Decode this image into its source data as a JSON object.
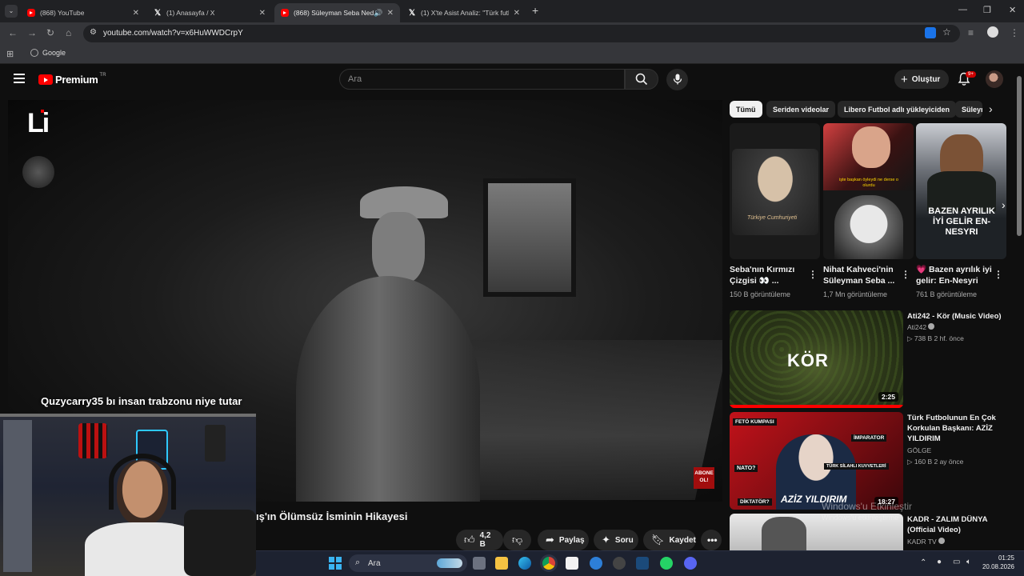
{
  "browser": {
    "tabs": [
      {
        "label": "(868) YouTube",
        "icon": "youtube"
      },
      {
        "label": "(1) Anasayfa / X",
        "icon": "x"
      },
      {
        "label": "(868) Süleyman Seba Neden",
        "icon": "youtube"
      },
      {
        "label": "(1) X'te Asist Analiz: \"Türk futbol",
        "icon": "x"
      }
    ],
    "url": "youtube.com/watch?v=x6HuWWDCrpY",
    "bookmark": "Google"
  },
  "youtube": {
    "logo_text": "Premium",
    "logo_region": "TR",
    "search_placeholder": "Ara",
    "create_label": "Oluştur",
    "notif_count": "9+",
    "accent": "#ff0000"
  },
  "video": {
    "overlay_logo": "Li",
    "caption": "Quzycarry35  bı insan trabzonu niye tutar",
    "abone_badge": "ABONE OL!",
    "title": "ış'ın Ölümsüz İsminin Hikayesi",
    "actions": {
      "likes": "4,2 B",
      "share": "Paylaş",
      "ask": "Soru",
      "save": "Kaydet"
    }
  },
  "chips": [
    "Tümü",
    "Seriden videolar",
    "Libero Futbol adlı yükleyiciden",
    "Süleyman"
  ],
  "shorts": [
    {
      "title": "Seba'nın Kırmızı Çizgisi 👀 ...",
      "views": "150 B görüntüleme",
      "thumb_text": "Türkiye Cumhuriyeti"
    },
    {
      "title": "Nihat Kahveci'nin Süleyman Seba ...",
      "views": "1,7 Mn görüntüleme",
      "thumb_text": "işte başkan öyleydi ne derse o olurdu"
    },
    {
      "title": "💗 Bazen ayrılık iyi gelir: En-Nesyri",
      "views": "761 B görüntüleme",
      "thumb_text": "BAZEN AYRILIK İYİ GELİR EN-NESYRI"
    }
  ],
  "videos": [
    {
      "title": "Ati242 - Kör (Music Video)",
      "channel": "Ati242",
      "meta": "738 B  2 hf. önce",
      "duration": "2:25",
      "thumb_text": "KÖR"
    },
    {
      "title": "Türk Futbolunun En Çok Korkulan Başkanı: AZİZ YILDIRIM",
      "channel": "GÖLGE",
      "meta": "160 B  2 ay önce",
      "duration": "18:27",
      "thumb_text": "AZİZ YILDIRIM",
      "thumb_tags": [
        "FETÖ KUMPASI",
        "İMPARATOR",
        "NATO?",
        "TÜRK SİLAHLI KUVVETLERİ",
        "DİKTATÖR?"
      ]
    },
    {
      "title": "KADR - ZALIM DÜNYA (Official Video)",
      "channel": "KADR TV",
      "meta": "",
      "duration": ""
    }
  ],
  "windows": {
    "watermark": "Windows'u Etkinleştir",
    "watermark_sub": "Windows'u etkinleştirme",
    "taskbar_search": "Ara",
    "time": "01:25",
    "date": "20.08.2026"
  }
}
